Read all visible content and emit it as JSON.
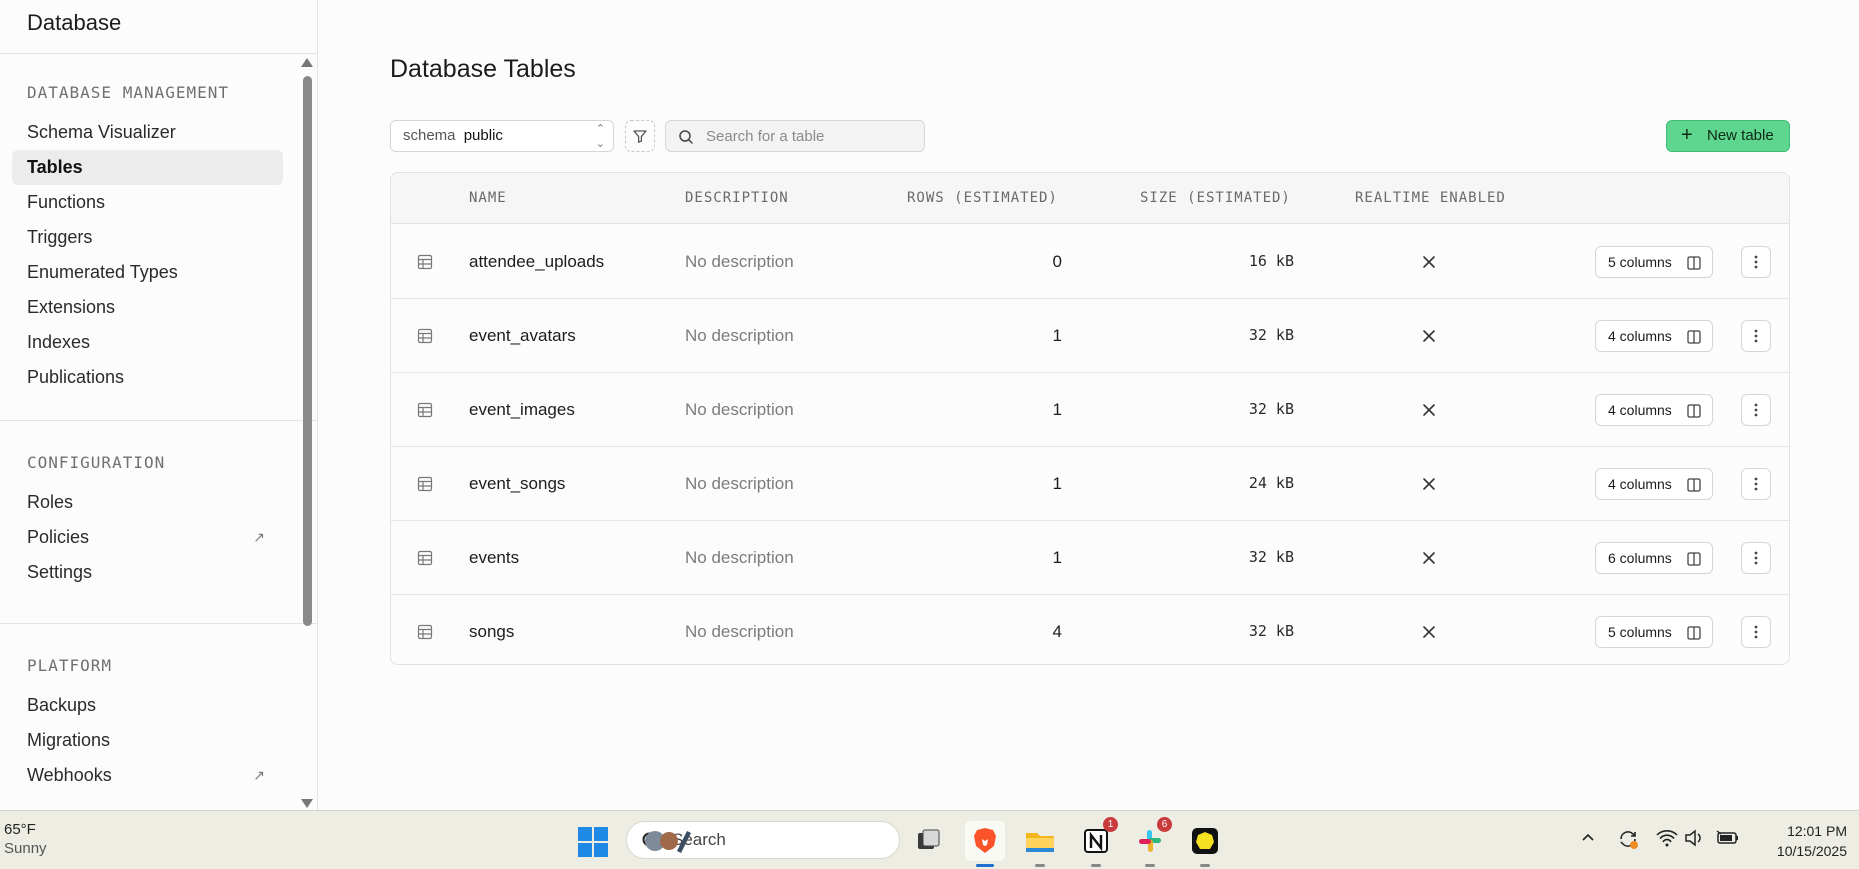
{
  "sidebar": {
    "title": "Database",
    "sections": [
      {
        "heading": "DATABASE MANAGEMENT",
        "items": [
          {
            "label": "Schema Visualizer"
          },
          {
            "label": "Tables",
            "active": true
          },
          {
            "label": "Functions"
          },
          {
            "label": "Triggers"
          },
          {
            "label": "Enumerated Types"
          },
          {
            "label": "Extensions"
          },
          {
            "label": "Indexes"
          },
          {
            "label": "Publications"
          }
        ]
      },
      {
        "heading": "CONFIGURATION",
        "items": [
          {
            "label": "Roles"
          },
          {
            "label": "Policies",
            "external": true
          },
          {
            "label": "Settings"
          }
        ]
      },
      {
        "heading": "PLATFORM",
        "items": [
          {
            "label": "Backups"
          },
          {
            "label": "Migrations"
          },
          {
            "label": "Webhooks",
            "external": true
          }
        ]
      }
    ]
  },
  "main": {
    "title": "Database Tables",
    "schema_label": "schema",
    "schema_value": "public",
    "search_placeholder": "Search for a table",
    "new_table_label": "New table",
    "columns": [
      "NAME",
      "DESCRIPTION",
      "ROWS (ESTIMATED)",
      "SIZE (ESTIMATED)",
      "REALTIME ENABLED"
    ],
    "rows": [
      {
        "name": "attendee_uploads",
        "description": "No description",
        "rows": "0",
        "size": "16 kB",
        "realtime": false,
        "columns_label": "5 columns"
      },
      {
        "name": "event_avatars",
        "description": "No description",
        "rows": "1",
        "size": "32 kB",
        "realtime": false,
        "columns_label": "4 columns"
      },
      {
        "name": "event_images",
        "description": "No description",
        "rows": "1",
        "size": "32 kB",
        "realtime": false,
        "columns_label": "4 columns"
      },
      {
        "name": "event_songs",
        "description": "No description",
        "rows": "1",
        "size": "24 kB",
        "realtime": false,
        "columns_label": "4 columns"
      },
      {
        "name": "events",
        "description": "No description",
        "rows": "1",
        "size": "32 kB",
        "realtime": false,
        "columns_label": "6 columns"
      },
      {
        "name": "songs",
        "description": "No description",
        "rows": "4",
        "size": "32 kB",
        "realtime": false,
        "columns_label": "5 columns"
      }
    ]
  },
  "taskbar": {
    "weather_temp": "65°F",
    "weather_cond": "Sunny",
    "search_label": "Search",
    "apps": [
      {
        "icon": "task-view-icon"
      },
      {
        "icon": "brave-browser-icon",
        "active": true
      },
      {
        "icon": "file-explorer-icon"
      },
      {
        "icon": "notion-icon",
        "badge": "1"
      },
      {
        "icon": "slack-icon",
        "badge": "6"
      },
      {
        "icon": "app-yellow-icon"
      }
    ],
    "time": "12:01 PM",
    "date": "10/15/2025"
  },
  "colors": {
    "accent_green": "#5ed68f",
    "badge_red": "#c93a3a",
    "active_indicator": "#1e6fd0"
  }
}
